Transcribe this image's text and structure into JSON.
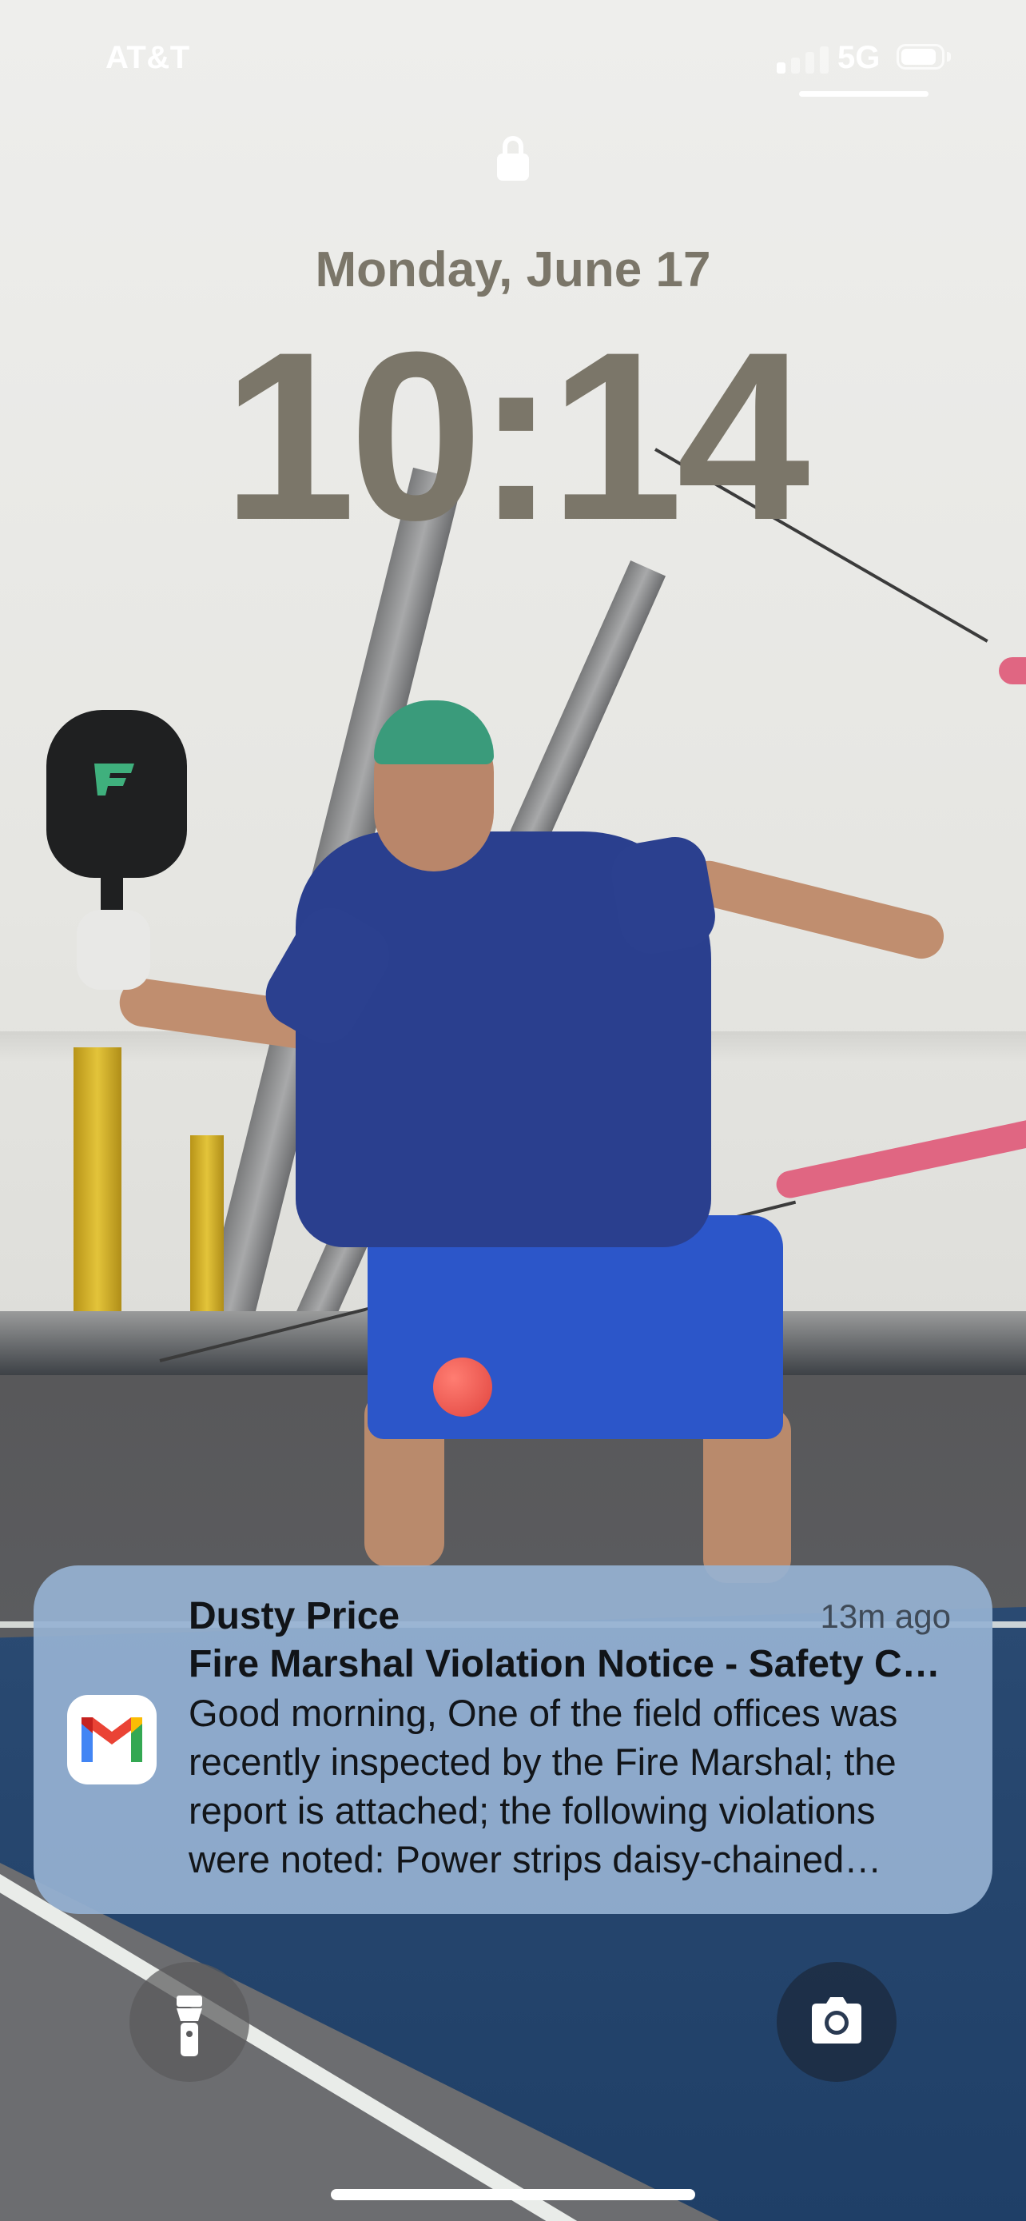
{
  "status_bar": {
    "carrier": "AT&T",
    "network_type": "5G",
    "signal_bars_active": 1,
    "signal_bars_total": 4,
    "battery_level": 0.9
  },
  "lock_screen": {
    "lock_icon": "lock-icon",
    "date": "Monday, June 17",
    "time": "10:14",
    "clock_color": "#7b7669"
  },
  "notification": {
    "app_icon": "gmail-icon",
    "sender": "Dusty Price",
    "timestamp": "13m ago",
    "subject": "Fire Marshal Violation Notice - Safety Concerns",
    "body": "Good morning, One of the field offices was recently inspected by the Fire Marshal; the report is attached; the following violations were noted: Power strips daisy-chained together"
  },
  "quick_actions": {
    "left_icon": "flashlight-icon",
    "right_icon": "camera-icon"
  }
}
